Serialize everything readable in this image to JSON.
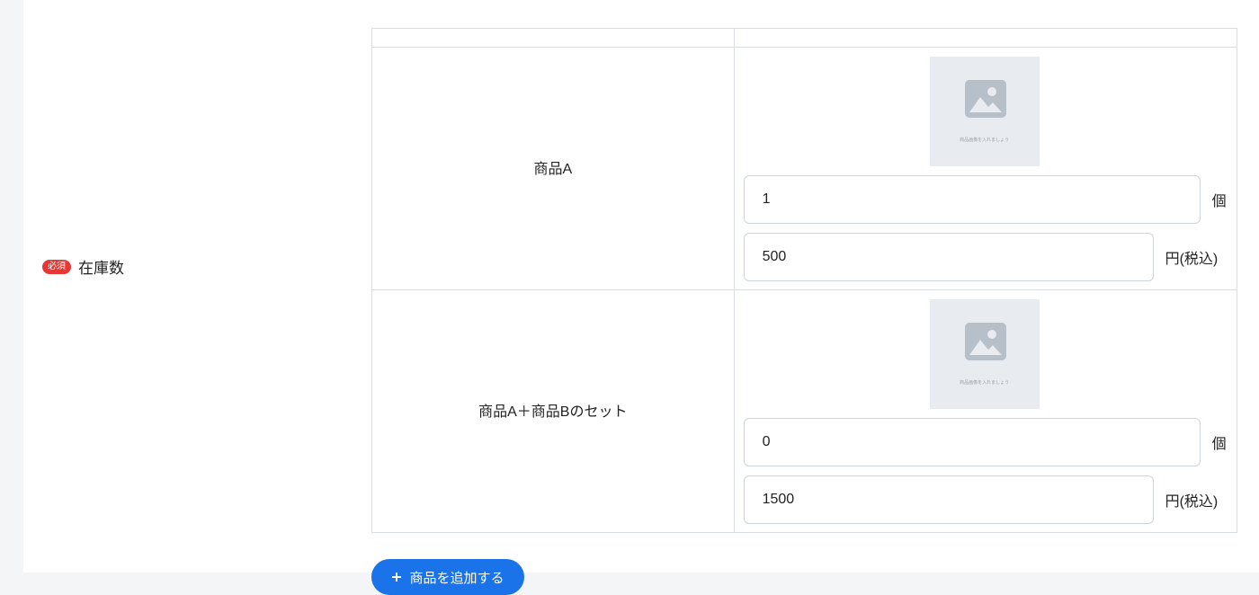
{
  "field": {
    "required_badge": "必須",
    "label": "在庫数"
  },
  "image_placeholder": {
    "icon": "image-icon",
    "caption": "商品画像を入れましょう"
  },
  "products": [
    {
      "name": "商品A",
      "quantity": "1",
      "quantity_unit": "個",
      "price": "500",
      "price_unit": "円(税込)"
    },
    {
      "name": "商品A＋商品Bのセット",
      "quantity": "0",
      "quantity_unit": "個",
      "price": "1500",
      "price_unit": "円(税込)"
    }
  ],
  "add_button": {
    "label": "商品を追加する",
    "icon": "plus-icon"
  },
  "colors": {
    "required": "#e53935",
    "accent": "#1a73e8",
    "placeholder_bg": "#e8ebef",
    "icon": "#b7bfc9"
  }
}
